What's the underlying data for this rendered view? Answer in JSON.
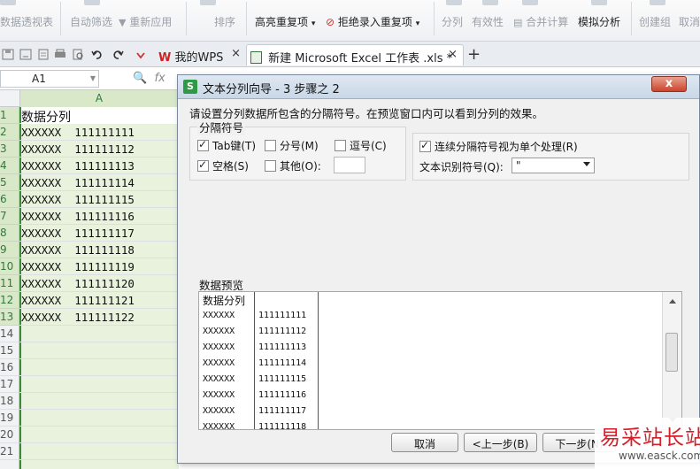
{
  "ribbon": {
    "pivot_label": "数据透视表",
    "autofilter_label": "自动筛选",
    "reapply_label": "重新应用",
    "sort_label": "排序",
    "highlight_dup_label": "高亮重复项",
    "reject_dup_label": "拒绝录入重复项",
    "split_label": "分列",
    "validity_label": "有效性",
    "consolidate_label": "合并计算",
    "simulate_label": "模拟分析",
    "group_label": "创建组",
    "ungroup_label": "取消"
  },
  "tabs": [
    {
      "label": "我的WPS",
      "close": "×"
    },
    {
      "label": "新建 Microsoft Excel 工作表 .xls *",
      "close": "×"
    }
  ],
  "new_tab": "+",
  "formula_bar": {
    "name_box": "A1",
    "fx": "fx"
  },
  "sheet": {
    "column_header": "A",
    "row_numbers": [
      "1",
      "2",
      "3",
      "4",
      "5",
      "6",
      "7",
      "8",
      "9",
      "10",
      "11",
      "12",
      "13",
      "14",
      "15",
      "16",
      "17",
      "18",
      "19",
      "20",
      "21"
    ],
    "cells": [
      "数据分列",
      "XXXXXX  111111111",
      "XXXXXX  111111112",
      "XXXXXX  111111113",
      "XXXXXX  111111114",
      "XXXXXX  111111115",
      "XXXXXX  111111116",
      "XXXXXX  111111117",
      "XXXXXX  111111118",
      "XXXXXX  111111119",
      "XXXXXX  111111120",
      "XXXXXX  111111121",
      "XXXXXX  111111122"
    ]
  },
  "dialog": {
    "app_icon": "S",
    "title": "文本分列向导 - 3 步骤之 2",
    "close": "x",
    "instruction": "请设置分列数据所包含的分隔符号。在预览窗口内可以看到分列的效果。",
    "delimiters_group": "分隔符号",
    "tab_label": "Tab键(T)",
    "tab_checked": true,
    "semicolon_label": "分号(M)",
    "semicolon_checked": false,
    "comma_label": "逗号(C)",
    "comma_checked": false,
    "space_label": "空格(S)",
    "space_checked": true,
    "other_label": "其他(O):",
    "other_checked": false,
    "other_value": "",
    "consecutive_label": "连续分隔符号视为单个处理(R)",
    "consecutive_checked": true,
    "qualifier_label": "文本识别符号(Q):",
    "qualifier_value": "\"",
    "preview_label": "数据预览",
    "preview_rows": [
      [
        "数据分列",
        ""
      ],
      [
        "XXXXXX",
        "111111111"
      ],
      [
        "XXXXXX",
        "111111112"
      ],
      [
        "XXXXXX",
        "111111113"
      ],
      [
        "XXXXXX",
        "111111114"
      ],
      [
        "XXXXXX",
        "111111115"
      ],
      [
        "XXXXXX",
        "111111116"
      ],
      [
        "XXXXXX",
        "111111117"
      ],
      [
        "XXXXXX",
        "111111118"
      ]
    ],
    "cancel_label": "取消",
    "back_label": "<上一步(B)",
    "next_label": "下一步(N)"
  },
  "watermark": {
    "name": "易采站长站",
    "url": "www.easck.com"
  },
  "colors": {
    "accent_green": "#3a8a3a",
    "selected_fill": "#e8f2dc",
    "close_red": "#c9452c",
    "watermark_red": "#d21f2a"
  }
}
